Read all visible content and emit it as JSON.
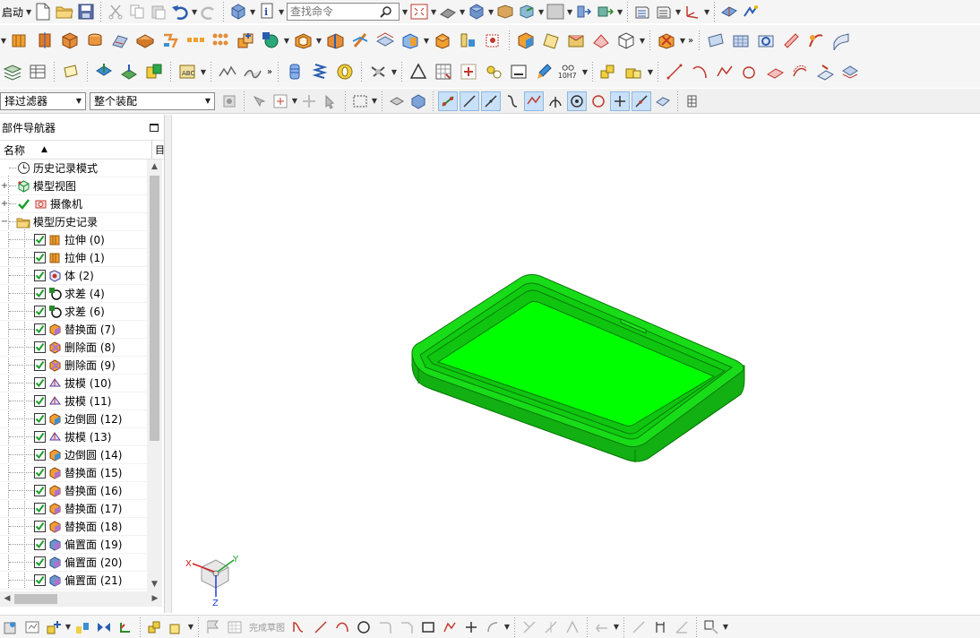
{
  "toolbar_top": {
    "start_label": "启动",
    "search_placeholder": "查找命令"
  },
  "selection_bar": {
    "filter_value": "择过滤器",
    "assembly_value": "整个装配"
  },
  "bottom_toolbar": {
    "finish_sketch_label": "完成草图"
  },
  "navigator": {
    "title": "部件导航器",
    "column_name": "名称",
    "column2": "目",
    "nodes": [
      {
        "label": "历史记录模式"
      },
      {
        "label": "模型视图"
      },
      {
        "label": "摄像机"
      },
      {
        "label": "模型历史记录"
      }
    ],
    "features": [
      {
        "label": "拉伸 (0)",
        "icon": "extrude-icon"
      },
      {
        "label": "拉伸 (1)",
        "icon": "extrude-icon"
      },
      {
        "label": "体 (2)",
        "icon": "body-icon"
      },
      {
        "label": "求差 (4)",
        "icon": "subtract-icon"
      },
      {
        "label": "求差 (6)",
        "icon": "subtract-icon"
      },
      {
        "label": "替换面 (7)",
        "icon": "replace-face-icon"
      },
      {
        "label": "删除面 (8)",
        "icon": "delete-face-icon"
      },
      {
        "label": "删除面 (9)",
        "icon": "delete-face-icon"
      },
      {
        "label": "拔模 (10)",
        "icon": "draft-icon"
      },
      {
        "label": "拔模 (11)",
        "icon": "draft-icon"
      },
      {
        "label": "边倒圆 (12)",
        "icon": "edge-blend-icon"
      },
      {
        "label": "拔模 (13)",
        "icon": "draft-icon"
      },
      {
        "label": "边倒圆 (14)",
        "icon": "edge-blend-icon"
      },
      {
        "label": "替换面 (15)",
        "icon": "replace-face-icon"
      },
      {
        "label": "替换面 (16)",
        "icon": "replace-face-icon"
      },
      {
        "label": "替换面 (17)",
        "icon": "replace-face-icon"
      },
      {
        "label": "替换面 (18)",
        "icon": "replace-face-icon"
      },
      {
        "label": "偏置面 (19)",
        "icon": "offset-face-icon"
      },
      {
        "label": "偏置面 (20)",
        "icon": "offset-face-icon"
      },
      {
        "label": "偏置面 (21)",
        "icon": "offset-face-icon"
      }
    ]
  },
  "triad": {
    "x_label": "X",
    "y_label": "Y",
    "z_label": "Z"
  },
  "colors": {
    "model_green": "#10d010",
    "model_edge": "#0a7a0a",
    "toolbar_bg": "#f5f5f5",
    "active_highlight": "#c8e0f8"
  }
}
